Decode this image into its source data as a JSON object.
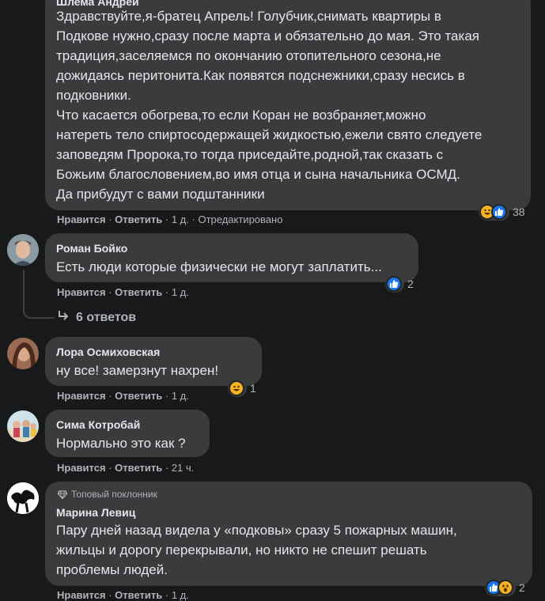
{
  "comments": [
    {
      "author": "Шлема Андрей",
      "text": "Здравствуйте,я-братец Апрель! Голубчик,снимать квартиры в\nПодкове нужно,сразу после марта и обязательно до мая. Это такая\nтрадиция,заселяемся по окончанию отопительного сезона,не\nдожидаясь перитонита.Как появятся подснежники,сразу несись в\nподковники.\nЧто касается обогрева,то если Коран не возбраняет,можно\nнатереть тело спиртосодержащей жидкостью,ежели свято следуете\nзаповедям Пророка,то тогда приседайте,родной,так сказать с\nБожьим благословением,во имя отца и сына начальника ОСМД.\nДа прибудут с вами подштанники",
      "like": "Нравится",
      "reply": "Ответить",
      "time": "1 д.",
      "edited": "Отредактировано",
      "reactions_count": "38"
    },
    {
      "author": "Роман Бойко",
      "text": "Есть люди которые физически не могут заплатить...",
      "like": "Нравится",
      "reply": "Ответить",
      "time": "1 д.",
      "reactions_count": "2",
      "replies_link": "6 ответов"
    },
    {
      "author": "Лора Осмиховская",
      "text": "ну все!  замерзнут нахрен!",
      "like": "Нравится",
      "reply": "Ответить",
      "time": "1 д.",
      "reactions_count": "1"
    },
    {
      "author": "Сима Котробай",
      "text": "Нормально это как ?",
      "like": "Нравится",
      "reply": "Ответить",
      "time": "21 ч."
    },
    {
      "badge": "Топовый поклонник",
      "author": "Марина Левиц",
      "text": "Пару дней назад видела у «подковы» сразу 5 пожарных машин,\nжильцы и дорогу перекрывали, но никто не спешит решать\nпроблемы людей.",
      "like": "Нравится",
      "reply": "Ответить",
      "time": "1 д.",
      "reactions_count": "2"
    }
  ],
  "separator": "·",
  "colors": {
    "background": "#18191a",
    "bubble": "#3a3b3c",
    "text": "#e4e6eb",
    "secondary": "#b0b3b8",
    "like_blue": "#1877f2",
    "haha_yellow": "#f7b125"
  }
}
